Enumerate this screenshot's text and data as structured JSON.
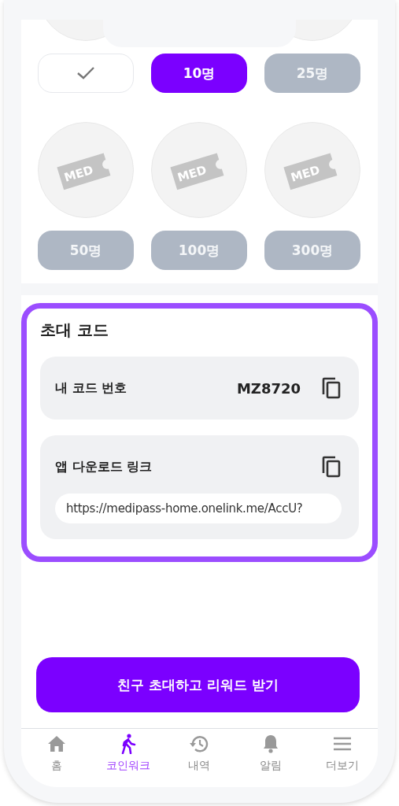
{
  "milestones_top": [
    {
      "completed": true
    },
    {
      "completed": false,
      "selected": true,
      "label": "10명"
    },
    {
      "completed": false,
      "selected": false,
      "label": "25명"
    }
  ],
  "milestones": [
    {
      "selected": false,
      "label": "50명",
      "ticket": "MED"
    },
    {
      "selected": false,
      "label": "100명",
      "ticket": "MED"
    },
    {
      "selected": false,
      "label": "300명",
      "ticket": "MED"
    }
  ],
  "invite_code": {
    "title": "초대 코드",
    "code_label": "내 코드 번호",
    "code": "MZ8720",
    "link_label": "앱 다운로드 링크",
    "link": "https://medipass-home.onelink.me/AccU?"
  },
  "cta": "친구 초대하고 리워드 받기",
  "tabs": [
    {
      "kind": "home",
      "label": "홈",
      "selected": false
    },
    {
      "kind": "walk",
      "label": "코인워크",
      "selected": true
    },
    {
      "kind": "history",
      "label": "내역",
      "selected": false
    },
    {
      "kind": "bell",
      "label": "알림",
      "selected": false
    },
    {
      "kind": "menu",
      "label": "더보기",
      "selected": false
    }
  ]
}
